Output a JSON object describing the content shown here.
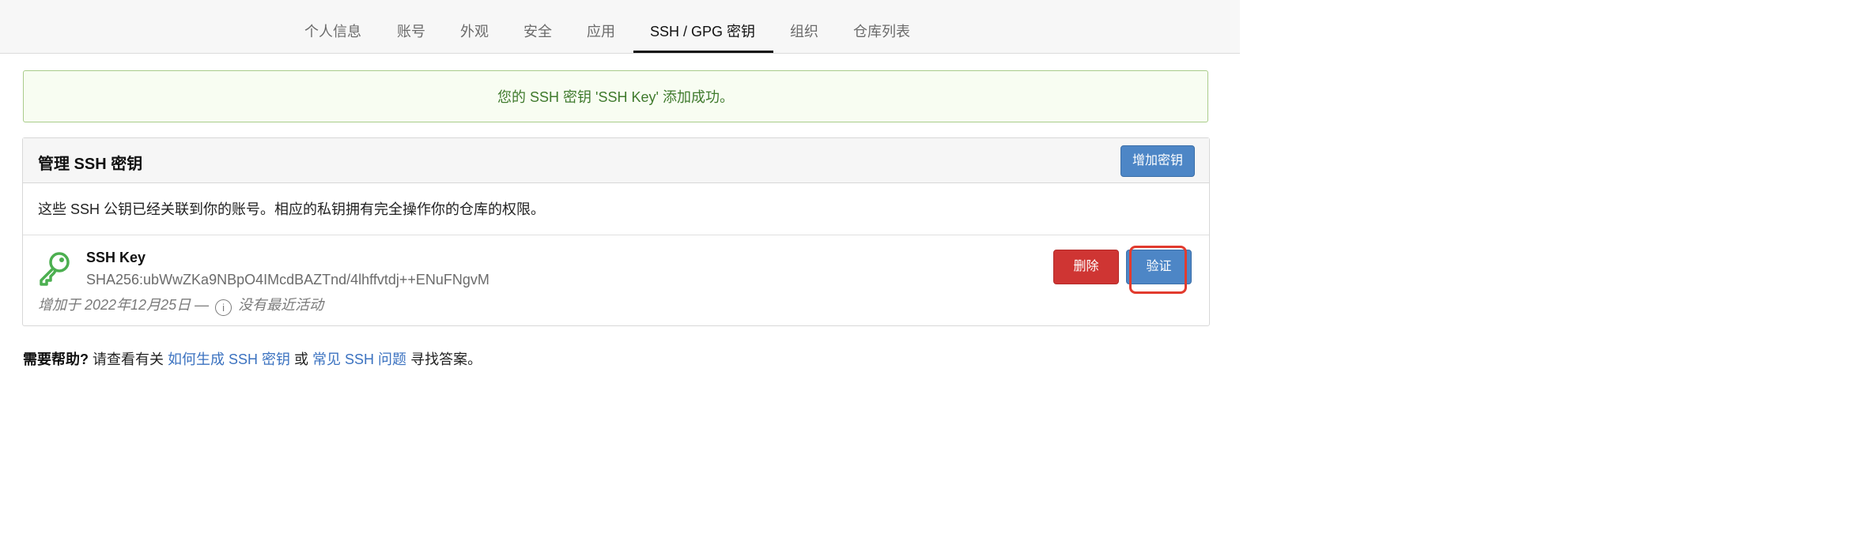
{
  "nav": {
    "tabs": [
      {
        "label": "个人信息"
      },
      {
        "label": "账号"
      },
      {
        "label": "外观"
      },
      {
        "label": "安全"
      },
      {
        "label": "应用"
      },
      {
        "label": "SSH / GPG 密钥",
        "active": true
      },
      {
        "label": "组织"
      },
      {
        "label": "仓库列表"
      }
    ]
  },
  "alert": {
    "message": "您的 SSH 密钥 'SSH Key' 添加成功。"
  },
  "panel": {
    "title": "管理 SSH 密钥",
    "add_button": "增加密钥",
    "description": "这些 SSH 公钥已经关联到你的账号。相应的私钥拥有完全操作你的仓库的权限。",
    "key": {
      "icon": "key-icon",
      "name": "SSH Key",
      "fingerprint": "SHA256:ubWwZKa9NBpO4IMcdBAZTnd/4lhffvtdj++ENuFNgvM",
      "added_prefix": "增加于 2022年12月25日 —",
      "activity": "没有最近活动",
      "delete_button": "删除",
      "verify_button": "验证"
    }
  },
  "help": {
    "strong": "需要帮助?",
    "text1": " 请查看有关 ",
    "link1": "如何生成 SSH 密钥",
    "text2": " 或 ",
    "link2": "常见 SSH 问题",
    "text3": " 寻找答案。"
  },
  "colors": {
    "accent_blue": "#4d86c6",
    "danger_red": "#cf3533",
    "success_green": "#3f7a2d",
    "highlight_red": "#e23b2e",
    "key_icon_green": "#4caf50"
  }
}
